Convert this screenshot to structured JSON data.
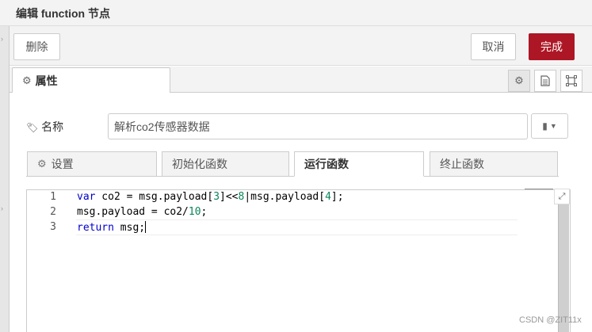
{
  "dialog": {
    "title": "编辑 function 节点"
  },
  "toolbar": {
    "delete_label": "删除",
    "cancel_label": "取消",
    "done_label": "完成"
  },
  "tabs": {
    "properties_label": "属性",
    "properties_icon": "gear-icon",
    "side_icons": [
      "gear-icon",
      "document-icon",
      "appearance-icon"
    ]
  },
  "form": {
    "name_label": "名称",
    "name_icon": "tag-icon",
    "name_value": "解析co2传感器数据",
    "library_icon": "book-icon"
  },
  "subtabs": {
    "items": [
      "设置",
      "初始化函数",
      "运行函数",
      "终止函数"
    ],
    "active": "运行函数"
  },
  "editor": {
    "line_numbers": [
      "1",
      "2",
      "3"
    ],
    "lines": [
      "var co2 = msg.payload[3]<<8|msg.payload[4];",
      "msg.payload = co2/10;",
      "return msg;"
    ]
  },
  "watermark": "CSDN @ZIT11x",
  "colors": {
    "accent": "#ad1625",
    "keyword": "#0000cc",
    "number": "#098658"
  }
}
